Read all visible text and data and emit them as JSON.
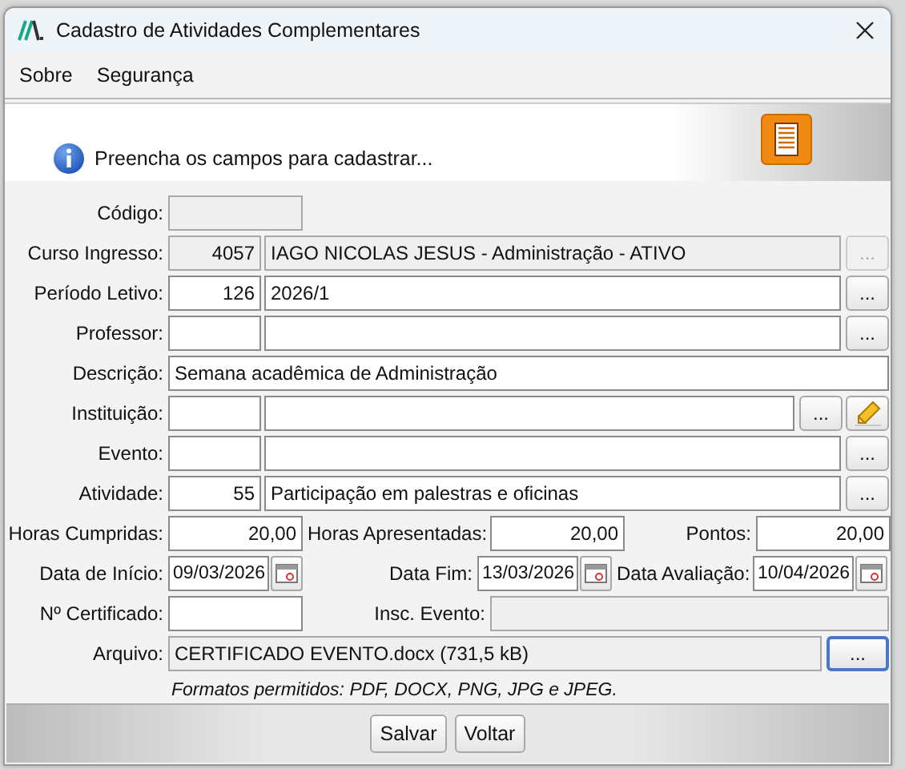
{
  "window": {
    "title": "Cadastro de Atividades Complementares"
  },
  "menu": [
    {
      "label": "Sobre"
    },
    {
      "label": "Segurança"
    }
  ],
  "header": {
    "message": "Preencha os campos para cadastrar..."
  },
  "form": {
    "rows": [
      {
        "kind": "short",
        "label": "Código:",
        "disabled": true
      },
      {
        "kind": "lookup",
        "label": "Curso Ingresso:",
        "code": "4057",
        "text": "IAGO NICOLAS JESUS - Administração - ATIVO",
        "disabled": true,
        "buttons": [
          {
            "kind": "browse",
            "label": "...",
            "disabled": true
          }
        ]
      },
      {
        "kind": "lookup",
        "label": "Período Letivo:",
        "code": "126",
        "text": "2026/1",
        "disabled": false,
        "buttons": [
          {
            "kind": "browse",
            "label": "...",
            "disabled": false
          }
        ]
      },
      {
        "kind": "lookup",
        "label": "Professor:",
        "disabled": false,
        "buttons": [
          {
            "kind": "browse",
            "label": "...",
            "disabled": false
          }
        ]
      },
      {
        "kind": "wide",
        "label": "Descrição:",
        "value": "Semana acadêmica de Administração",
        "disabled": false
      },
      {
        "kind": "lookup",
        "label": "Instituição:",
        "disabled": false,
        "buttons": [
          {
            "kind": "browse",
            "label": "...",
            "disabled": false
          },
          {
            "kind": "edit",
            "disabled": false
          }
        ]
      },
      {
        "kind": "lookup",
        "label": "Evento:",
        "disabled": false,
        "buttons": [
          {
            "kind": "browse",
            "label": "...",
            "disabled": false
          }
        ]
      },
      {
        "kind": "lookup",
        "label": "Atividade:",
        "code": "55",
        "text": "Participação em palestras e oficinas",
        "disabled": false,
        "buttons": [
          {
            "kind": "browse",
            "label": "...",
            "disabled": false
          }
        ]
      },
      {
        "kind": "numbers",
        "items": [
          {
            "label": "Horas Cumpridas:",
            "value": "20,00"
          },
          {
            "label": "Horas Apresentadas:",
            "value": "20,00"
          },
          {
            "label": "Pontos:",
            "value": "20,00"
          }
        ]
      },
      {
        "kind": "dates",
        "items": [
          {
            "label": "Data de Início:",
            "value": "09/03/2026"
          },
          {
            "label": "Data Fim:",
            "value": "13/03/2026"
          },
          {
            "label": "Data Avaliação:",
            "value": "10/04/2026"
          }
        ]
      },
      {
        "kind": "pair",
        "items": [
          {
            "label": "Nº Certificado:",
            "disabled": false
          },
          {
            "label": "Insc. Evento:",
            "disabled": true
          }
        ]
      },
      {
        "kind": "file",
        "label": "Arquivo:",
        "value": "CERTIFICADO EVENTO.docx (731,5 kB)",
        "button": {
          "label": "...",
          "focused": true
        }
      }
    ],
    "hint": "Formatos permitidos: PDF, DOCX, PNG, JPG e JPEG."
  },
  "buttons": [
    {
      "label": "Salvar"
    },
    {
      "label": "Voltar"
    }
  ]
}
